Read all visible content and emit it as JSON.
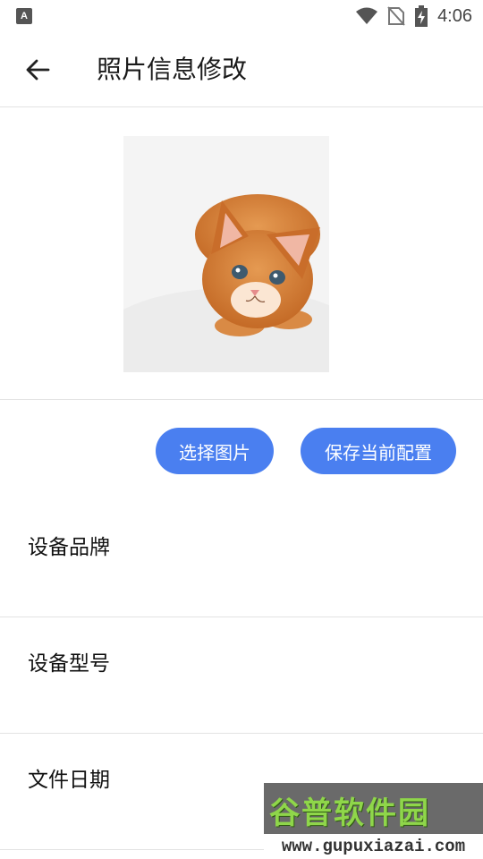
{
  "status_bar": {
    "left_icon": "A",
    "time": "4:06",
    "icons": [
      "wifi-icon",
      "no-sim-icon",
      "battery-charging-icon"
    ]
  },
  "toolbar": {
    "back_icon": "arrow-left-icon",
    "title": "照片信息修改"
  },
  "photo": {
    "description_icon": "cat-photo"
  },
  "actions": {
    "select_label": "选择图片",
    "save_label": "保存当前配置",
    "accent_color": "#4a7ff0"
  },
  "fields": [
    {
      "label": "设备品牌",
      "value": ""
    },
    {
      "label": "设备型号",
      "value": ""
    },
    {
      "label": "文件日期",
      "value": ""
    }
  ],
  "watermark": {
    "brand": "谷普软件园",
    "url": "www.gupuxiazai.com"
  }
}
